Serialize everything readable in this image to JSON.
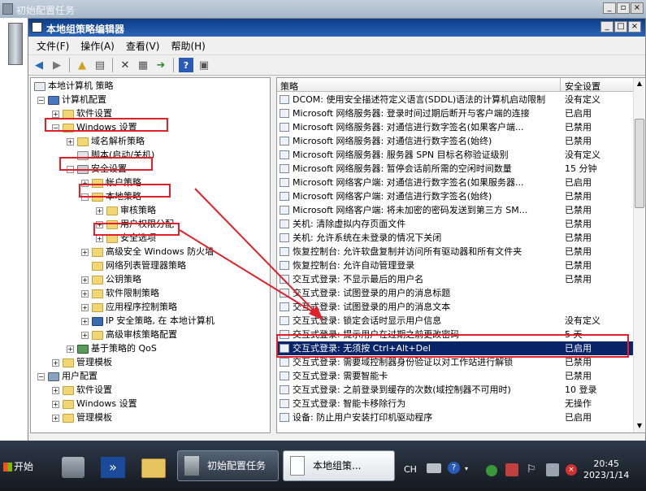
{
  "outer": {
    "title": "初始配置任务"
  },
  "window": {
    "title": "本地组策略编辑器"
  },
  "menu": [
    "文件(F)",
    "操作(A)",
    "查看(V)",
    "帮助(H)"
  ],
  "tree": [
    {
      "label": "本地计算机 策略",
      "level": 0,
      "exp": "",
      "icon": "computer-icon"
    },
    {
      "label": "计算机配置",
      "level": 1,
      "exp": "-",
      "icon": "computer-icon"
    },
    {
      "label": "软件设置",
      "level": 2,
      "exp": "+",
      "icon": "folder-icon"
    },
    {
      "label": "Windows 设置",
      "level": 2,
      "exp": "-",
      "icon": "folder-icon"
    },
    {
      "label": "域名解析策略",
      "level": 3,
      "exp": "+",
      "icon": "folder-icon"
    },
    {
      "label": "脚本(启动/关机)",
      "level": 3,
      "exp": "",
      "icon": "script-icon"
    },
    {
      "label": "安全设置",
      "level": 3,
      "exp": "-",
      "icon": "folder-icon"
    },
    {
      "label": "帐户策略",
      "level": 4,
      "exp": "+",
      "icon": "folder-icon"
    },
    {
      "label": "本地策略",
      "level": 4,
      "exp": "-",
      "icon": "folder-icon"
    },
    {
      "label": "审核策略",
      "level": 5,
      "exp": "+",
      "icon": "folder-icon"
    },
    {
      "label": "用户权限分配",
      "level": 5,
      "exp": "+",
      "icon": "folder-icon"
    },
    {
      "label": "安全选项",
      "level": 5,
      "exp": "+",
      "icon": "folder-icon"
    },
    {
      "label": "高级安全 Windows 防火墙",
      "level": 4,
      "exp": "+",
      "icon": "folder-icon"
    },
    {
      "label": "网络列表管理器策略",
      "level": 4,
      "exp": "",
      "icon": "folder-icon"
    },
    {
      "label": "公钥策略",
      "level": 4,
      "exp": "+",
      "icon": "folder-icon"
    },
    {
      "label": "软件限制策略",
      "level": 4,
      "exp": "+",
      "icon": "folder-icon"
    },
    {
      "label": "应用程序控制策略",
      "level": 4,
      "exp": "+",
      "icon": "folder-icon"
    },
    {
      "label": "IP 安全策略, 在 本地计算机",
      "level": 4,
      "exp": "+",
      "icon": "ip-icon"
    },
    {
      "label": "高级审核策略配置",
      "level": 4,
      "exp": "+",
      "icon": "folder-icon"
    },
    {
      "label": "基于策略的 QoS",
      "level": 3,
      "exp": "+",
      "icon": "chart-icon"
    },
    {
      "label": "管理模板",
      "level": 2,
      "exp": "+",
      "icon": "folder-icon"
    },
    {
      "label": "用户配置",
      "level": 1,
      "exp": "-",
      "icon": "user-icon"
    },
    {
      "label": "软件设置",
      "level": 2,
      "exp": "+",
      "icon": "folder-icon"
    },
    {
      "label": "Windows 设置",
      "level": 2,
      "exp": "+",
      "icon": "folder-icon"
    },
    {
      "label": "管理模板",
      "level": 2,
      "exp": "+",
      "icon": "folder-icon"
    }
  ],
  "list": {
    "headers": [
      "策略",
      "安全设置"
    ],
    "rows": [
      {
        "name": "DCOM: 使用安全描述符定义语言(SDDL)语法的计算机启动限制",
        "value": "没有定义"
      },
      {
        "name": "Microsoft 网络服务器: 登录时间过期后断开与客户端的连接",
        "value": "已启用"
      },
      {
        "name": "Microsoft 网络服务器: 对通信进行数字签名(如果客户端...",
        "value": "已禁用"
      },
      {
        "name": "Microsoft 网络服务器: 对通信进行数字签名(始终)",
        "value": "已禁用"
      },
      {
        "name": "Microsoft 网络服务器: 服务器 SPN 目标名称验证级别",
        "value": "没有定义"
      },
      {
        "name": "Microsoft 网络服务器: 暂停会话前所需的空闲时间数量",
        "value": "15 分钟"
      },
      {
        "name": "Microsoft 网络客户端: 对通信进行数字签名(如果服务器...",
        "value": "已启用"
      },
      {
        "name": "Microsoft 网络客户端: 对通信进行数字签名(始终)",
        "value": "已禁用"
      },
      {
        "name": "Microsoft 网络客户端: 将未加密的密码发送到第三方 SM...",
        "value": "已禁用"
      },
      {
        "name": "关机: 清除虚拟内存页面文件",
        "value": "已禁用"
      },
      {
        "name": "关机: 允许系统在未登录的情况下关闭",
        "value": "已禁用"
      },
      {
        "name": "恢复控制台: 允许软盘复制并访问所有驱动器和所有文件夹",
        "value": "已禁用"
      },
      {
        "name": "恢复控制台: 允许自动管理登录",
        "value": "已禁用"
      },
      {
        "name": "交互式登录: 不显示最后的用户名",
        "value": "已禁用"
      },
      {
        "name": "交互式登录: 试图登录的用户的消息标题",
        "value": ""
      },
      {
        "name": "交互式登录: 试图登录的用户的消息文本",
        "value": ""
      },
      {
        "name": "交互式登录: 锁定会话时显示用户信息",
        "value": "没有定义"
      },
      {
        "name": "交互式登录: 提示用户在过期之前更改密码",
        "value": "5 天"
      },
      {
        "name": "交互式登录: 无须按 Ctrl+Alt+Del",
        "value": "已启用"
      },
      {
        "name": "交互式登录: 需要域控制器身份验证以对工作站进行解锁",
        "value": "已禁用"
      },
      {
        "name": "交互式登录: 需要智能卡",
        "value": "已禁用"
      },
      {
        "name": "交互式登录: 之前登录到缓存的次数(域控制器不可用时)",
        "value": "10 登录"
      },
      {
        "name": "交互式登录: 智能卡移除行为",
        "value": "无操作"
      },
      {
        "name": "设备: 防止用户安装打印机驱动程序",
        "value": "已启用"
      }
    ]
  },
  "taskbar": {
    "start": "开始",
    "task1": "初始配置任务",
    "task2": "本地组策...",
    "lang": "CH",
    "time": "20:45",
    "date": "2023/1/14"
  }
}
